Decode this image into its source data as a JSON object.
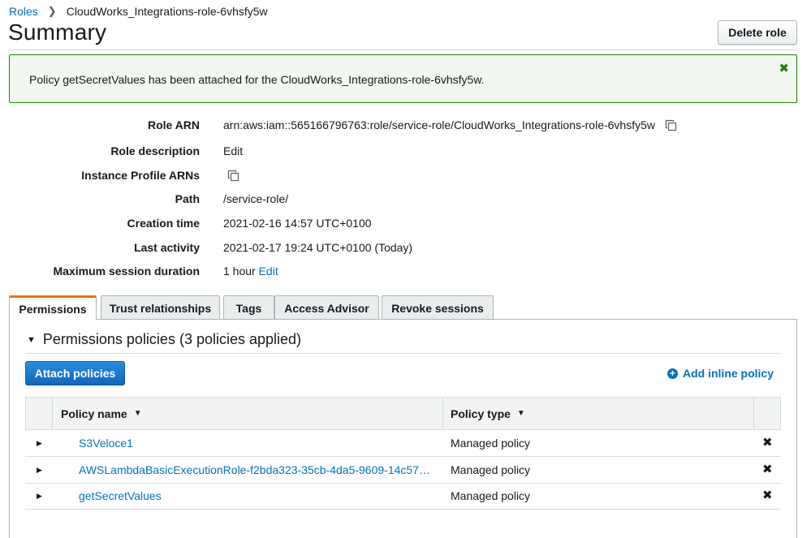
{
  "breadcrumb": {
    "parent": "Roles",
    "current": "CloudWorks_Integrations-role-6vhsfy5w"
  },
  "page": {
    "title": "Summary",
    "delete_label": "Delete role"
  },
  "flash": {
    "message": "Policy getSecretValues has been attached for the CloudWorks_Integrations-role-6vhsfy5w.",
    "color": "#1d8102"
  },
  "details": {
    "role_arn_label": "Role ARN",
    "role_arn": "arn:aws:iam::565166796763:role/service-role/CloudWorks_Integrations-role-6vhsfy5w",
    "description_label": "Role description",
    "description_edit": "Edit",
    "instance_profile_label": "Instance Profile ARNs",
    "path_label": "Path",
    "path": "/service-role/",
    "creation_label": "Creation time",
    "creation": "2021-02-16 14:57 UTC+0100",
    "activity_label": "Last activity",
    "activity": "2021-02-17 19:24 UTC+0100 (Today)",
    "session_label": "Maximum session duration",
    "session": "1 hour",
    "session_edit": "Edit"
  },
  "tabs": [
    "Permissions",
    "Trust relationships",
    "Tags",
    "Access Advisor",
    "Revoke sessions"
  ],
  "permissions": {
    "heading": "Permissions policies (3 policies applied)",
    "attach_label": "Attach policies",
    "inline_label": "Add inline policy",
    "columns": {
      "name": "Policy name",
      "type": "Policy type"
    },
    "rows": [
      {
        "name": "S3Veloce1",
        "type": "Managed policy"
      },
      {
        "name": "AWSLambdaBasicExecutionRole-f2bda323-35cb-4da5-9609-14c57e1…",
        "type": "Managed policy"
      },
      {
        "name": "getSecretValues",
        "type": "Managed policy"
      }
    ]
  },
  "colors": {
    "accent": "#ec7211",
    "link": "#0073bb",
    "primary_button": "#1166bb"
  }
}
